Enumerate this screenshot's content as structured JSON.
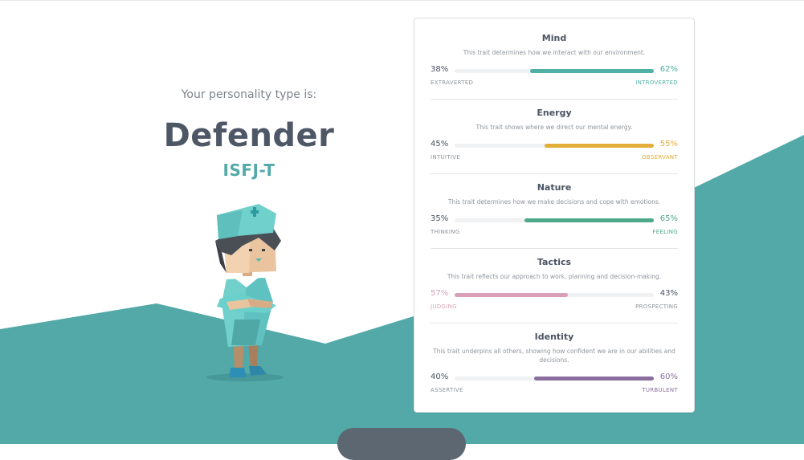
{
  "hero": {
    "subtitle": "Your personality type is:",
    "title": "Defender",
    "code": "ISFJ-T"
  },
  "colors": {
    "teal_bg": "#52a9a8",
    "mind": "#4fb0a6",
    "energy": "#e4ae3a",
    "nature": "#4ea98a",
    "tactics": "#d7a1b9",
    "identity": "#8a6f9e",
    "neutral_text": "#4b5362"
  },
  "traits": [
    {
      "name": "Mind",
      "description": "This trait determines how we interact with our environment.",
      "left_pct": "38%",
      "right_pct": "62%",
      "left_label": "EXTRAVERTED",
      "right_label": "INTROVERTED",
      "dominant": "right",
      "dominant_value": 0.62,
      "color": "#4fb0a6"
    },
    {
      "name": "Energy",
      "description": "This trait shows where we direct our mental energy.",
      "left_pct": "45%",
      "right_pct": "55%",
      "left_label": "INTUITIVE",
      "right_label": "OBSERVANT",
      "dominant": "right",
      "dominant_value": 0.55,
      "color": "#e4ae3a"
    },
    {
      "name": "Nature",
      "description": "This trait determines how we make decisions and cope with emotions.",
      "left_pct": "35%",
      "right_pct": "65%",
      "left_label": "THINKING",
      "right_label": "FEELING",
      "dominant": "right",
      "dominant_value": 0.65,
      "color": "#4ea98a"
    },
    {
      "name": "Tactics",
      "description": "This trait reflects our approach to work, planning and decision-making.",
      "left_pct": "57%",
      "right_pct": "43%",
      "left_label": "JUDGING",
      "right_label": "PROSPECTING",
      "dominant": "left",
      "dominant_value": 0.57,
      "color": "#d7a1b9"
    },
    {
      "name": "Identity",
      "description": "This trait underpins all others, showing how confident we are in our abilities and decisions.",
      "left_pct": "40%",
      "right_pct": "60%",
      "left_label": "ASSERTIVE",
      "right_label": "TURBULENT",
      "dominant": "right",
      "dominant_value": 0.6,
      "color": "#8a6f9e"
    }
  ]
}
